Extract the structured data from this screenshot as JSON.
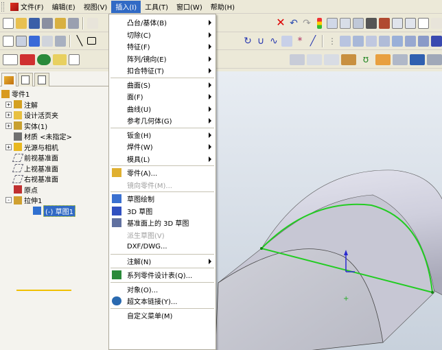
{
  "menubar": {
    "items": [
      {
        "label": "文件(F)",
        "icon": "app-icon"
      },
      {
        "label": "编辑(E)"
      },
      {
        "label": "视图(V)"
      },
      {
        "label": "插入(I)",
        "active": true
      },
      {
        "label": "工具(T)"
      },
      {
        "label": "窗口(W)"
      },
      {
        "label": "帮助(H)"
      }
    ]
  },
  "feature_tree": {
    "tabs": [
      "feature-manager-tab",
      "property-manager-tab",
      "configuration-manager-tab"
    ],
    "nodes": [
      {
        "label": "零件1",
        "icon": "part-icon"
      },
      {
        "label": "注解",
        "icon": "annotation-icon",
        "expand": "+"
      },
      {
        "label": "设计活页夹",
        "icon": "design-binder-icon",
        "expand": "+"
      },
      {
        "label": "实体(1)",
        "icon": "solid-bodies-icon",
        "expand": "+"
      },
      {
        "label": "材质 <未指定>",
        "icon": "material-icon"
      },
      {
        "label": "光源与相机",
        "icon": "lights-cameras-icon",
        "expand": "+"
      },
      {
        "label": "前视基准面",
        "icon": "plane-icon"
      },
      {
        "label": "上视基准面",
        "icon": "plane-icon"
      },
      {
        "label": "右视基准面",
        "icon": "plane-icon"
      },
      {
        "label": "原点",
        "icon": "origin-icon"
      },
      {
        "label": "拉伸1",
        "icon": "extrude-icon",
        "expand": "-"
      },
      {
        "label": "(-) 草图1",
        "icon": "sketch-icon",
        "selected": true
      }
    ]
  },
  "insert_menu": {
    "items": [
      {
        "label": "凸台/基体(B)",
        "submenu": true
      },
      {
        "label": "切除(C)",
        "submenu": true
      },
      {
        "label": "特征(F)",
        "submenu": true
      },
      {
        "label": "阵列/镜向(E)",
        "submenu": true
      },
      {
        "label": "扣合特征(T)",
        "submenu": true
      },
      {
        "sep": true
      },
      {
        "label": "曲面(S)",
        "submenu": true
      },
      {
        "label": "面(F)",
        "submenu": true
      },
      {
        "label": "曲线(U)",
        "submenu": true
      },
      {
        "label": "参考几何体(G)",
        "submenu": true
      },
      {
        "sep": true
      },
      {
        "label": "钣金(H)",
        "submenu": true
      },
      {
        "label": "焊件(W)",
        "submenu": true
      },
      {
        "label": "模具(L)",
        "submenu": true
      },
      {
        "sep": true
      },
      {
        "label": "零件(A)...",
        "icon": "insert-part-icon"
      },
      {
        "label": "镜向零件(M)...",
        "disabled": true
      },
      {
        "sep": true
      },
      {
        "label": "草图绘制",
        "icon": "sketch-icon"
      },
      {
        "label": "3D 草图",
        "icon": "3d-sketch-icon"
      },
      {
        "label": "基准面上的 3D 草图",
        "icon": "3d-sketch-on-plane-icon"
      },
      {
        "label": "派生草图(V)",
        "disabled": true
      },
      {
        "label": "DXF/DWG..."
      },
      {
        "sep": true
      },
      {
        "label": "注解(N)",
        "submenu": true
      },
      {
        "sep": true
      },
      {
        "label": "系列零件设计表(Q)...",
        "icon": "design-table-icon"
      },
      {
        "sep": true
      },
      {
        "label": "对象(O)..."
      },
      {
        "label": "超文本链接(Y)...",
        "icon": "hyperlink-icon"
      },
      {
        "sep": true
      },
      {
        "label": "自定义菜单(M)"
      }
    ]
  },
  "colors": {
    "accent": "#316ac5",
    "body": "#b8b8c6",
    "sketch": "#22cc22"
  }
}
